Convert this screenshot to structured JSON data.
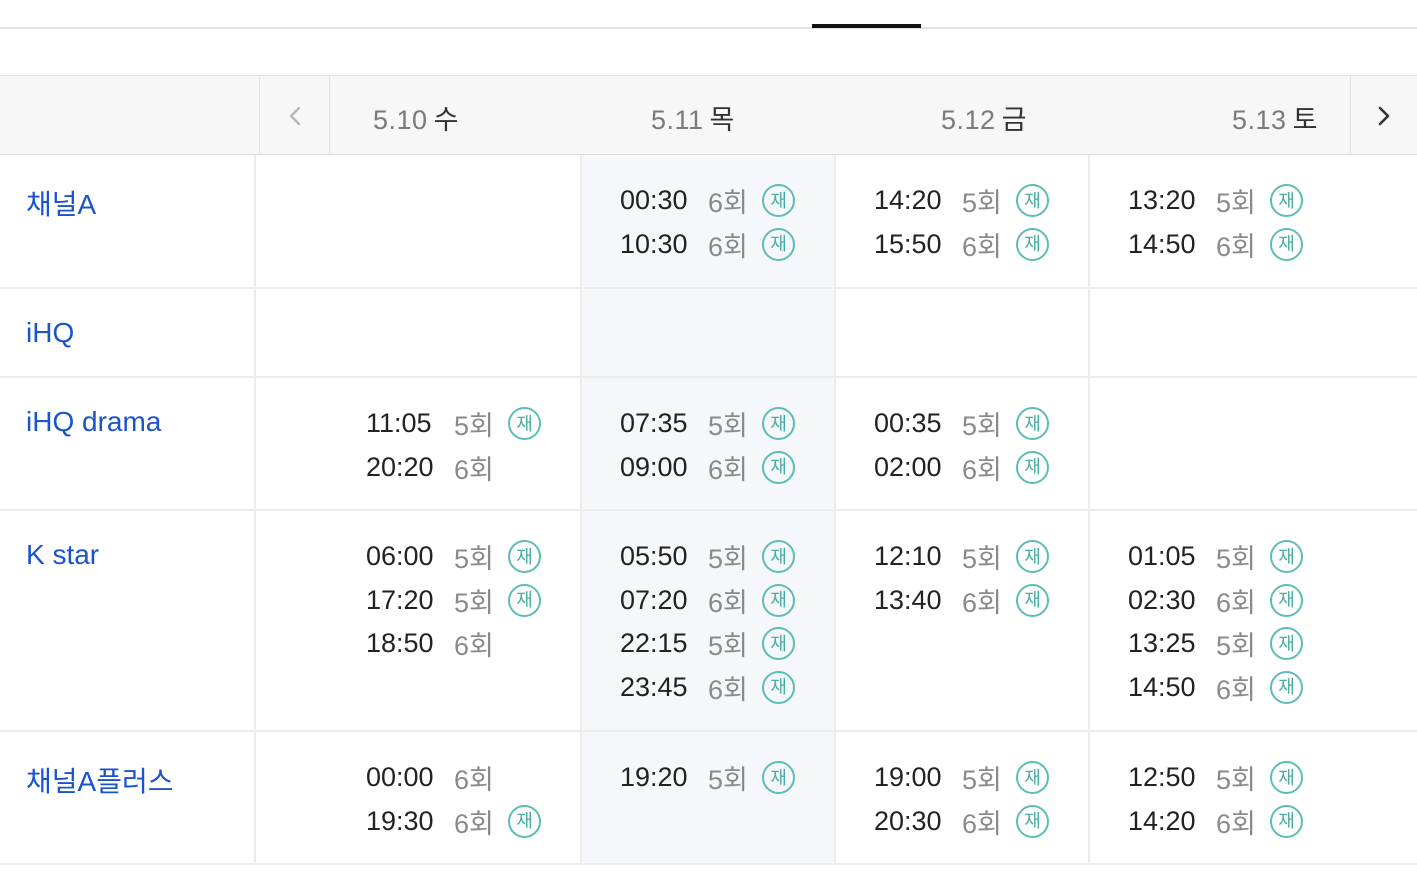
{
  "header": {
    "prev_label": "이전",
    "next_label": "다음",
    "dates": [
      {
        "date": "5.10",
        "dow": "수"
      },
      {
        "date": "5.11",
        "dow": "목"
      },
      {
        "date": "5.12",
        "dow": "금"
      },
      {
        "date": "5.13",
        "dow": "토"
      }
    ]
  },
  "rerun_mark": "재",
  "channels": [
    {
      "name": "채널A",
      "days": [
        [],
        [
          {
            "time": "00:30",
            "ep": "6회",
            "rerun": true
          },
          {
            "time": "10:30",
            "ep": "6회",
            "rerun": true
          }
        ],
        [
          {
            "time": "14:20",
            "ep": "5회",
            "rerun": true
          },
          {
            "time": "15:50",
            "ep": "6회",
            "rerun": true
          }
        ],
        [
          {
            "time": "13:20",
            "ep": "5회",
            "rerun": true
          },
          {
            "time": "14:50",
            "ep": "6회",
            "rerun": true
          }
        ]
      ]
    },
    {
      "name": "iHQ",
      "days": [
        [],
        [],
        [],
        []
      ]
    },
    {
      "name": "iHQ drama",
      "days": [
        [
          {
            "time": "11:05",
            "ep": "5회",
            "rerun": true
          },
          {
            "time": "20:20",
            "ep": "6회",
            "rerun": false
          }
        ],
        [
          {
            "time": "07:35",
            "ep": "5회",
            "rerun": true
          },
          {
            "time": "09:00",
            "ep": "6회",
            "rerun": true
          }
        ],
        [
          {
            "time": "00:35",
            "ep": "5회",
            "rerun": true
          },
          {
            "time": "02:00",
            "ep": "6회",
            "rerun": true
          }
        ],
        []
      ]
    },
    {
      "name": "K star",
      "days": [
        [
          {
            "time": "06:00",
            "ep": "5회",
            "rerun": true
          },
          {
            "time": "17:20",
            "ep": "5회",
            "rerun": true
          },
          {
            "time": "18:50",
            "ep": "6회",
            "rerun": false
          }
        ],
        [
          {
            "time": "05:50",
            "ep": "5회",
            "rerun": true
          },
          {
            "time": "07:20",
            "ep": "6회",
            "rerun": true
          },
          {
            "time": "22:15",
            "ep": "5회",
            "rerun": true
          },
          {
            "time": "23:45",
            "ep": "6회",
            "rerun": true
          }
        ],
        [
          {
            "time": "12:10",
            "ep": "5회",
            "rerun": true
          },
          {
            "time": "13:40",
            "ep": "6회",
            "rerun": true
          }
        ],
        [
          {
            "time": "01:05",
            "ep": "5회",
            "rerun": true
          },
          {
            "time": "02:30",
            "ep": "6회",
            "rerun": true
          },
          {
            "time": "13:25",
            "ep": "5회",
            "rerun": true
          },
          {
            "time": "14:50",
            "ep": "6회",
            "rerun": true
          }
        ]
      ]
    },
    {
      "name": "채널A플러스",
      "days": [
        [
          {
            "time": "00:00",
            "ep": "6회",
            "rerun": false
          },
          {
            "time": "19:30",
            "ep": "6회",
            "rerun": true
          }
        ],
        [
          {
            "time": "19:20",
            "ep": "5회",
            "rerun": true
          }
        ],
        [
          {
            "time": "19:00",
            "ep": "5회",
            "rerun": true
          },
          {
            "time": "20:30",
            "ep": "6회",
            "rerun": true
          }
        ],
        [
          {
            "time": "12:50",
            "ep": "5회",
            "rerun": true
          },
          {
            "time": "14:20",
            "ep": "6회",
            "rerun": true
          }
        ]
      ]
    }
  ],
  "colors": {
    "channel_link": "#1a53cc",
    "rerun_badge": "#5bbdb4",
    "today_column_bg": "#f5f7fa"
  }
}
